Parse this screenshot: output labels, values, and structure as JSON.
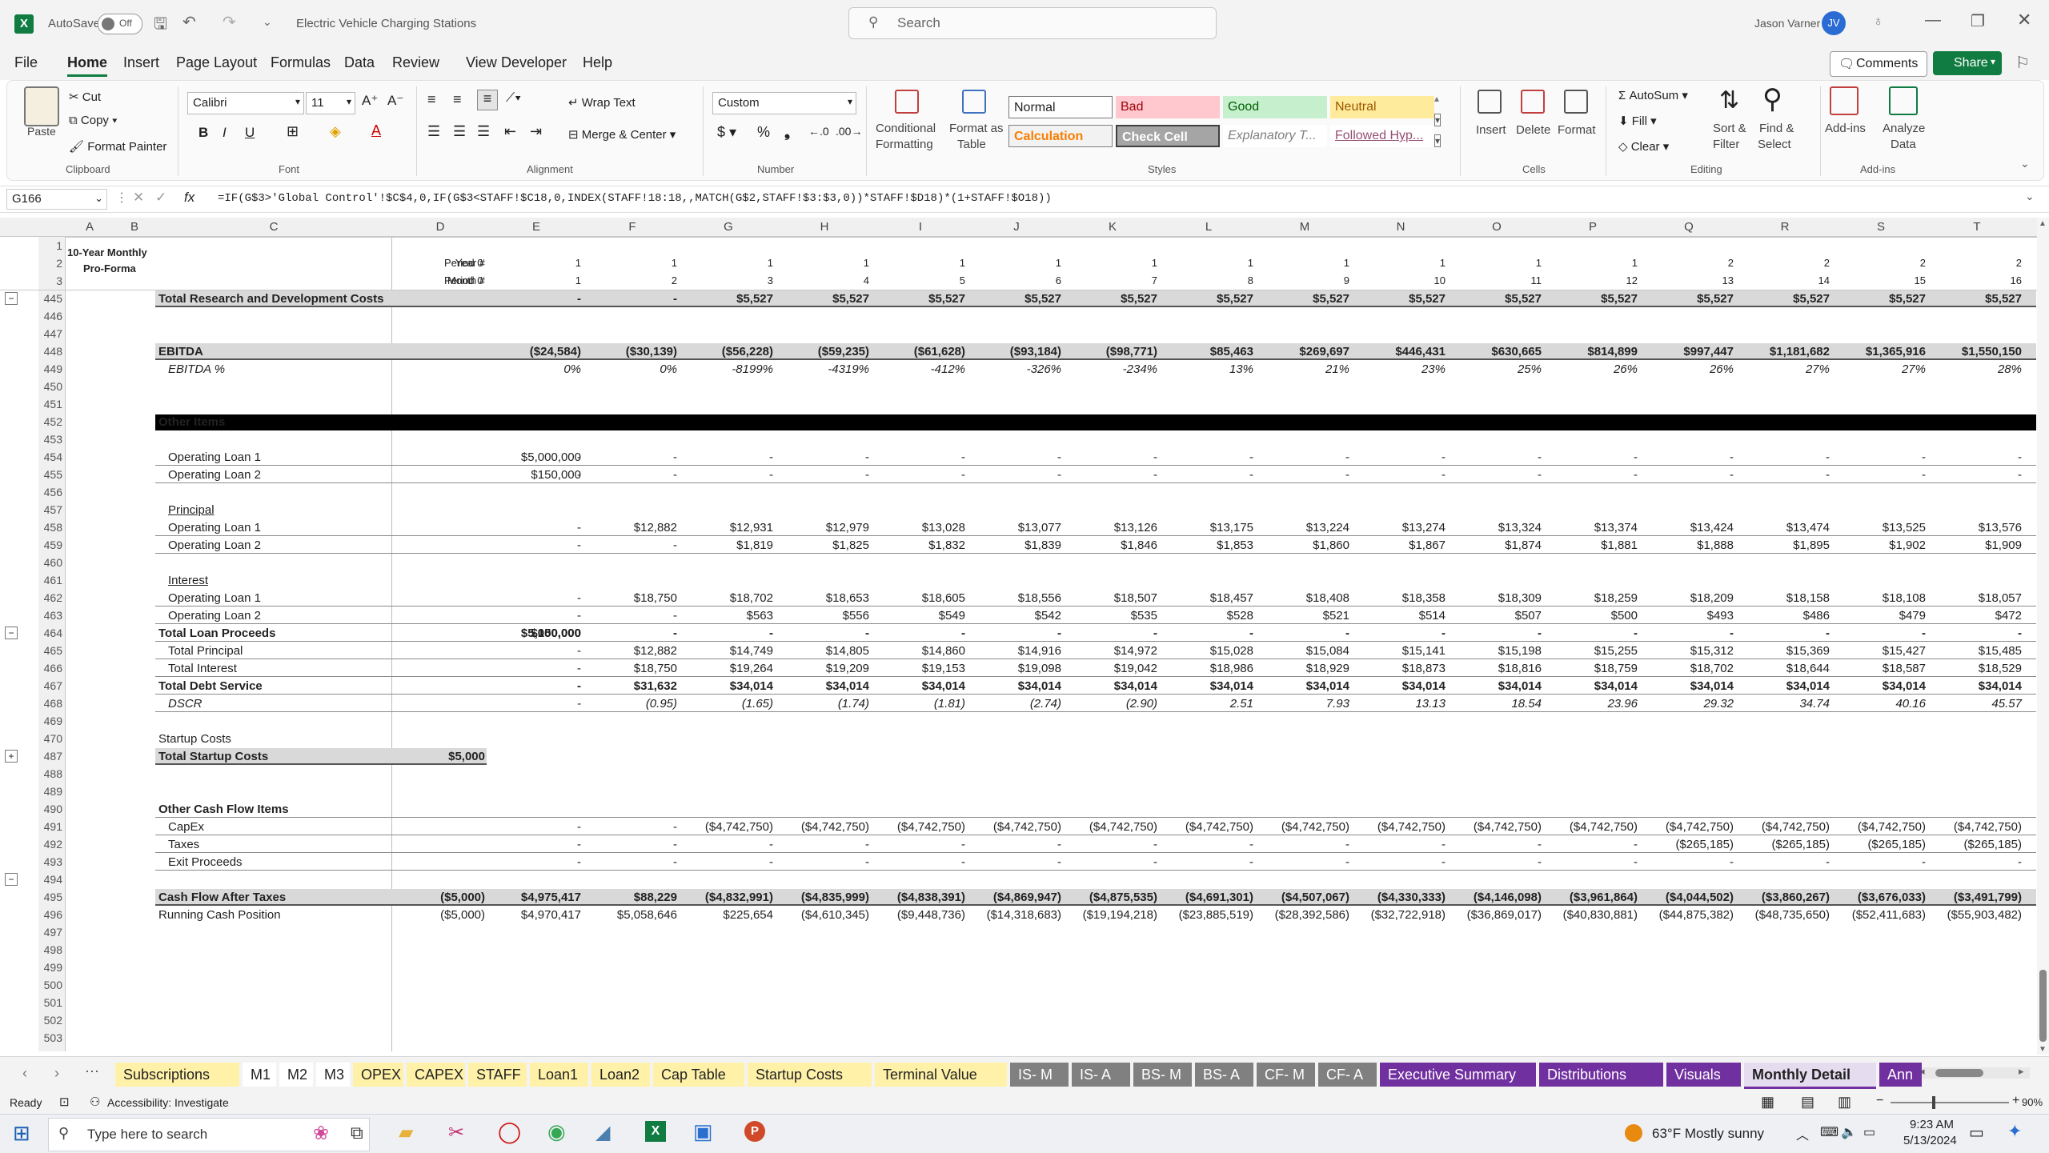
{
  "titlebar": {
    "autosave_label": "AutoSave",
    "autosave_state": "Off",
    "file_name": "Electric Vehicle Charging Stations",
    "search_placeholder": "Search",
    "user_name": "Jason Varner",
    "user_initials": "JV"
  },
  "menu": [
    "File",
    "Home",
    "Insert",
    "Page Layout",
    "Formulas",
    "Data",
    "Review",
    "View",
    "Developer",
    "Help"
  ],
  "menu_active": "Home",
  "comments_label": "Comments",
  "share_label": "Share",
  "ribbon": {
    "clipboard": {
      "paste": "Paste",
      "cut": "Cut",
      "copy": "Copy",
      "format_painter": "Format Painter",
      "label": "Clipboard"
    },
    "font": {
      "family": "Calibri",
      "size": "11",
      "label": "Font"
    },
    "alignment": {
      "wrap": "Wrap Text",
      "merge": "Merge & Center",
      "label": "Alignment"
    },
    "number": {
      "format": "Custom",
      "label": "Number"
    },
    "styles": {
      "conditional": "Conditional",
      "conditional2": "Formatting",
      "format_as": "Format as",
      "table": "Table",
      "cells": [
        [
          "Normal",
          "Bad",
          "Good",
          "Neutral"
        ],
        [
          "Calculation",
          "Check Cell",
          "Explanatory T...",
          "Followed Hyp..."
        ]
      ],
      "label": "Styles"
    },
    "cells": {
      "insert": "Insert",
      "delete": "Delete",
      "format": "Format",
      "label": "Cells"
    },
    "editing": {
      "autosum": "AutoSum",
      "fill": "Fill",
      "clear": "Clear",
      "sort": "Sort &",
      "filter": "Filter",
      "find": "Find &",
      "select": "Select",
      "label": "Editing"
    },
    "addins": {
      "addins": "Add-ins",
      "analyze": "Analyze",
      "data": "Data",
      "label": "Add-ins"
    }
  },
  "formula": {
    "namebox": "G166",
    "fx": "fx",
    "text": "=IF(G$3>'Global Control'!$C$4,0,IF(G$3<STAFF!$C18,0,INDEX(STAFF!18:18,,MATCH(G$2,STAFF!$3:$3,0))*STAFF!$D18)*(1+STAFF!$O18))"
  },
  "columns": [
    "A",
    "B",
    "C",
    "D",
    "E",
    "F",
    "G",
    "H",
    "I",
    "J",
    "K",
    "L",
    "M",
    "N",
    "O",
    "P",
    "Q",
    "R",
    "S",
    "T"
  ],
  "header": {
    "title1": "10-Year Monthly",
    "title2": "Pro-Forma",
    "year_label": "Year #",
    "month_label": "Month #",
    "period": "Period 0",
    "years": [
      "1",
      "1",
      "1",
      "1",
      "1",
      "1",
      "1",
      "1",
      "1",
      "1",
      "1",
      "1",
      "2",
      "2",
      "2",
      "2"
    ],
    "months": [
      "1",
      "2",
      "3",
      "4",
      "5",
      "6",
      "7",
      "8",
      "9",
      "10",
      "11",
      "12",
      "13",
      "14",
      "15",
      "16"
    ]
  },
  "rows": [
    {
      "r": "445",
      "label": "Total Research and Development Costs",
      "style": "total",
      "d": "",
      "v": [
        "-",
        "-",
        "$5,527",
        "$5,527",
        "$5,527",
        "$5,527",
        "$5,527",
        "$5,527",
        "$5,527",
        "$5,527",
        "$5,527",
        "$5,527",
        "$5,527",
        "$5,527",
        "$5,527",
        "$5,527"
      ]
    },
    {
      "r": "446"
    },
    {
      "r": "447"
    },
    {
      "r": "448",
      "label": "EBITDA",
      "style": "total",
      "d": "",
      "v": [
        "($24,584)",
        "($30,139)",
        "($56,228)",
        "($59,235)",
        "($61,628)",
        "($93,184)",
        "($98,771)",
        "$85,463",
        "$269,697",
        "$446,431",
        "$630,665",
        "$814,899",
        "$997,447",
        "$1,181,682",
        "$1,365,916",
        "$1,550,150"
      ]
    },
    {
      "r": "449",
      "label": "EBITDA %",
      "style": "italic",
      "d": "",
      "v": [
        "0%",
        "0%",
        "-8199%",
        "-4319%",
        "-412%",
        "-326%",
        "-234%",
        "13%",
        "21%",
        "23%",
        "25%",
        "26%",
        "26%",
        "27%",
        "27%",
        "28%"
      ]
    },
    {
      "r": "450"
    },
    {
      "r": "451"
    },
    {
      "r": "452",
      "label": "Other Items",
      "style": "black"
    },
    {
      "r": "453"
    },
    {
      "r": "454",
      "label": "Operating Loan 1",
      "style": "boxed",
      "d": "$5,000,000",
      "v": [
        "-",
        "-",
        "-",
        "-",
        "-",
        "-",
        "-",
        "-",
        "-",
        "-",
        "-",
        "-",
        "-",
        "-",
        "-",
        "-"
      ]
    },
    {
      "r": "455",
      "label": "Operating Loan 2",
      "style": "boxed",
      "d": "-",
      "v": [
        "$150,000",
        "-",
        "-",
        "-",
        "-",
        "-",
        "-",
        "-",
        "-",
        "-",
        "-",
        "-",
        "-",
        "-",
        "-",
        "-"
      ]
    },
    {
      "r": "456"
    },
    {
      "r": "457",
      "label": "Principal",
      "style": "underline"
    },
    {
      "r": "458",
      "label": "Operating Loan 1",
      "style": "boxed",
      "d": "-",
      "v": [
        "$12,882",
        "$12,931",
        "$12,979",
        "$13,028",
        "$13,077",
        "$13,126",
        "$13,175",
        "$13,224",
        "$13,274",
        "$13,324",
        "$13,374",
        "$13,424",
        "$13,474",
        "$13,525",
        "$13,576"
      ],
      "shift": true
    },
    {
      "r": "459",
      "label": "Operating Loan 2",
      "style": "boxed",
      "d": "-",
      "v": [
        "-",
        "$1,819",
        "$1,825",
        "$1,832",
        "$1,839",
        "$1,846",
        "$1,853",
        "$1,860",
        "$1,867",
        "$1,874",
        "$1,881",
        "$1,888",
        "$1,895",
        "$1,902",
        "$1,909"
      ],
      "shift": true
    },
    {
      "r": "460"
    },
    {
      "r": "461",
      "label": "Interest",
      "style": "underline"
    },
    {
      "r": "462",
      "label": "Operating Loan 1",
      "style": "boxed",
      "d": "-",
      "v": [
        "$18,750",
        "$18,702",
        "$18,653",
        "$18,605",
        "$18,556",
        "$18,507",
        "$18,457",
        "$18,408",
        "$18,358",
        "$18,309",
        "$18,259",
        "$18,209",
        "$18,158",
        "$18,108",
        "$18,057"
      ],
      "shift": true
    },
    {
      "r": "463",
      "label": "Operating Loan 2",
      "style": "boxed",
      "d": "-",
      "v": [
        "-",
        "$563",
        "$556",
        "$549",
        "$542",
        "$535",
        "$528",
        "$521",
        "$514",
        "$507",
        "$500",
        "$493",
        "$486",
        "$479",
        "$472"
      ],
      "shift": true
    },
    {
      "r": "464",
      "label": "Total Loan Proceeds",
      "style": "bold",
      "d": "$5,000,000",
      "v": [
        "$150,000",
        "-",
        "-",
        "-",
        "-",
        "-",
        "-",
        "-",
        "-",
        "-",
        "-",
        "-",
        "-",
        "-",
        "-",
        "-"
      ]
    },
    {
      "r": "465",
      "label": "Total Principal",
      "style": "indent",
      "d": "-",
      "v": [
        "$12,882",
        "$14,749",
        "$14,805",
        "$14,860",
        "$14,916",
        "$14,972",
        "$15,028",
        "$15,084",
        "$15,141",
        "$15,198",
        "$15,255",
        "$15,312",
        "$15,369",
        "$15,427",
        "$15,485"
      ],
      "shift": true
    },
    {
      "r": "466",
      "label": "Total Interest",
      "style": "indent",
      "d": "-",
      "v": [
        "$18,750",
        "$19,264",
        "$19,209",
        "$19,153",
        "$19,098",
        "$19,042",
        "$18,986",
        "$18,929",
        "$18,873",
        "$18,816",
        "$18,759",
        "$18,702",
        "$18,644",
        "$18,587",
        "$18,529"
      ],
      "shift": true
    },
    {
      "r": "467",
      "label": "Total Debt Service",
      "style": "bold",
      "d": "-",
      "v": [
        "$31,632",
        "$34,014",
        "$34,014",
        "$34,014",
        "$34,014",
        "$34,014",
        "$34,014",
        "$34,014",
        "$34,014",
        "$34,014",
        "$34,014",
        "$34,014",
        "$34,014",
        "$34,014",
        "$34,014"
      ],
      "shift": true
    },
    {
      "r": "468",
      "label": "DSCR",
      "style": "italicindent",
      "d": "-",
      "v": [
        "(0.95)",
        "(1.65)",
        "(1.74)",
        "(1.81)",
        "(2.74)",
        "(2.90)",
        "2.51",
        "7.93",
        "13.13",
        "18.54",
        "23.96",
        "29.32",
        "34.74",
        "40.16",
        "45.57"
      ],
      "shift": true
    },
    {
      "r": "469"
    },
    {
      "r": "470",
      "label": "Startup Costs",
      "style": "plain"
    },
    {
      "r": "487",
      "label": "Total Startup Costs",
      "style": "startup",
      "c": "$5,000"
    },
    {
      "r": "488"
    },
    {
      "r": "489"
    },
    {
      "r": "490",
      "label": "Other Cash Flow Items",
      "style": "bold"
    },
    {
      "r": "491",
      "label": "CapEx",
      "style": "boxed",
      "d": "-",
      "v": [
        "-",
        "($4,742,750)",
        "($4,742,750)",
        "($4,742,750)",
        "($4,742,750)",
        "($4,742,750)",
        "($4,742,750)",
        "($4,742,750)",
        "($4,742,750)",
        "($4,742,750)",
        "($4,742,750)",
        "($4,742,750)",
        "($4,742,750)",
        "($4,742,750)",
        "($4,742,750)"
      ],
      "shift": true
    },
    {
      "r": "492",
      "label": "Taxes",
      "style": "boxed",
      "d": "-",
      "v": [
        "-",
        "-",
        "-",
        "-",
        "-",
        "-",
        "-",
        "-",
        "-",
        "-",
        "-",
        "($265,185)",
        "($265,185)",
        "($265,185)",
        "($265,185)"
      ],
      "shift": true
    },
    {
      "r": "493",
      "label": "Exit Proceeds",
      "style": "boxed",
      "d": "-",
      "v": [
        "-",
        "-",
        "-",
        "-",
        "-",
        "-",
        "-",
        "-",
        "-",
        "-",
        "-",
        "-",
        "-",
        "-",
        "-"
      ],
      "shift": true
    },
    {
      "r": "494"
    },
    {
      "r": "495",
      "label": "Cash Flow After Taxes",
      "style": "total",
      "c": "($5,000)",
      "d": "$4,975,417",
      "v": [
        "$88,229",
        "($4,832,991)",
        "($4,835,999)",
        "($4,838,391)",
        "($4,869,947)",
        "($4,875,535)",
        "($4,691,301)",
        "($4,507,067)",
        "($4,330,333)",
        "($4,146,098)",
        "($3,961,864)",
        "($4,044,502)",
        "($3,860,267)",
        "($3,676,033)",
        "($3,491,799)"
      ],
      "shift": true
    },
    {
      "r": "496",
      "label": "Running Cash Position",
      "style": "plain",
      "c": "($5,000)",
      "d": "$4,970,417",
      "v": [
        "$5,058,646",
        "$225,654",
        "($4,610,345)",
        "($9,448,736)",
        "($14,318,683)",
        "($19,194,218)",
        "($23,885,519)",
        "($28,392,586)",
        "($32,722,918)",
        "($36,869,017)",
        "($40,830,881)",
        "($44,875,382)",
        "($48,735,650)",
        "($52,411,683)",
        "($55,903,482)"
      ],
      "shift": true
    },
    {
      "r": "497"
    },
    {
      "r": "498"
    },
    {
      "r": "499"
    },
    {
      "r": "500"
    },
    {
      "r": "501"
    },
    {
      "r": "502"
    },
    {
      "r": "503"
    }
  ],
  "tabs": [
    {
      "name": "Subscriptions",
      "bg": "#fff2a8",
      "fg": "#222"
    },
    {
      "name": "M1",
      "bg": "#ffffff",
      "fg": "#222"
    },
    {
      "name": "M2",
      "bg": "#ffffff",
      "fg": "#222"
    },
    {
      "name": "M3",
      "bg": "#ffffff",
      "fg": "#222"
    },
    {
      "name": "OPEX",
      "bg": "#fff2a8",
      "fg": "#222"
    },
    {
      "name": "CAPEX",
      "bg": "#fff2a8",
      "fg": "#222"
    },
    {
      "name": "STAFF",
      "bg": "#fff2a8",
      "fg": "#222"
    },
    {
      "name": "Loan1",
      "bg": "#fff2a8",
      "fg": "#222"
    },
    {
      "name": "Loan2",
      "bg": "#fff2a8",
      "fg": "#222"
    },
    {
      "name": "Cap Table",
      "bg": "#fff2a8",
      "fg": "#222"
    },
    {
      "name": "Startup Costs",
      "bg": "#fff2a8",
      "fg": "#222"
    },
    {
      "name": "Terminal Value",
      "bg": "#fff2a8",
      "fg": "#222"
    },
    {
      "name": "IS- M",
      "bg": "#808080",
      "fg": "#fff"
    },
    {
      "name": "IS- A",
      "bg": "#808080",
      "fg": "#fff"
    },
    {
      "name": "BS- M",
      "bg": "#808080",
      "fg": "#fff"
    },
    {
      "name": "BS- A",
      "bg": "#808080",
      "fg": "#fff"
    },
    {
      "name": "CF- M",
      "bg": "#808080",
      "fg": "#fff"
    },
    {
      "name": "CF- A",
      "bg": "#808080",
      "fg": "#fff"
    },
    {
      "name": "Executive Summary",
      "bg": "#7030a0",
      "fg": "#fff"
    },
    {
      "name": "Distributions",
      "bg": "#7030a0",
      "fg": "#fff"
    },
    {
      "name": "Visuals",
      "bg": "#7030a0",
      "fg": "#fff"
    },
    {
      "name": "Monthly Detail",
      "bg": "#e6dcf0",
      "fg": "#222",
      "active": true
    },
    {
      "name": "Ann",
      "bg": "#7030a0",
      "fg": "#fff"
    }
  ],
  "status": {
    "ready": "Ready",
    "accessibility": "Accessibility: Investigate",
    "zoom": "90%"
  },
  "taskbar": {
    "search_placeholder": "Type here to search",
    "weather": "63°F  Mostly sunny",
    "time": "9:23 AM",
    "date": "5/13/2024"
  }
}
